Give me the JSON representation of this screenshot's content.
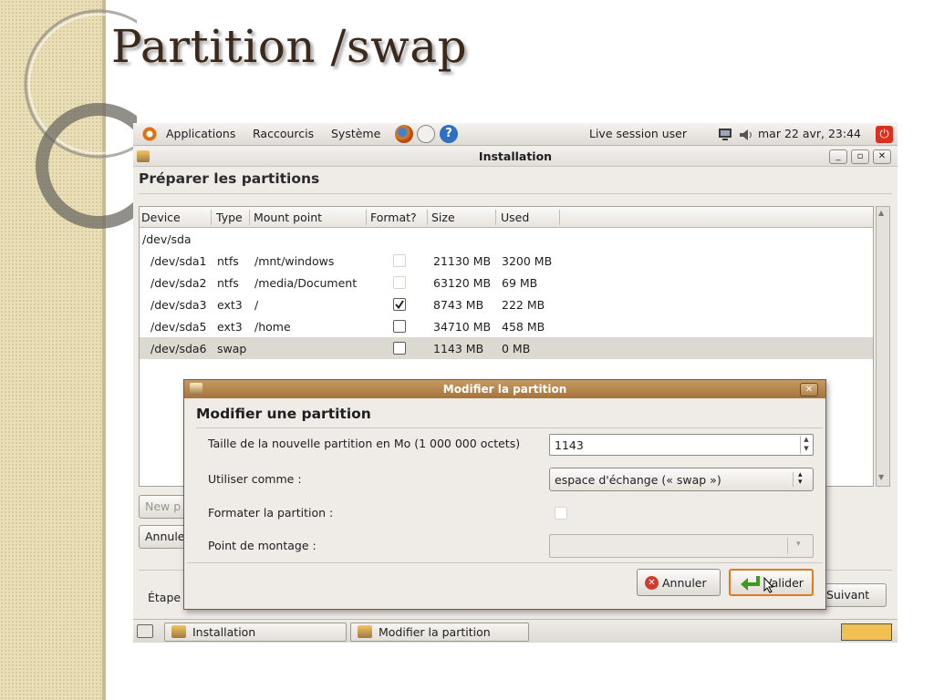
{
  "slide": {
    "title": "Partition /swap"
  },
  "panel": {
    "menus": [
      "Applications",
      "Raccourcis",
      "Système"
    ],
    "user": "Live session user",
    "clock": "mar 22 avr, 23:44"
  },
  "window": {
    "title": "Installation",
    "heading": "Préparer les partitions",
    "columns": [
      "Device",
      "Type",
      "Mount point",
      "Format?",
      "Size",
      "Used"
    ],
    "disk": "/dev/sda",
    "rows": [
      {
        "device": "/dev/sda1",
        "type": "ntfs",
        "mount": "/mnt/windows",
        "format": false,
        "size": "21130 MB",
        "used": "3200 MB"
      },
      {
        "device": "/dev/sda2",
        "type": "ntfs",
        "mount": "/media/Document",
        "format": false,
        "size": "63120 MB",
        "used": "69 MB"
      },
      {
        "device": "/dev/sda3",
        "type": "ext3",
        "mount": "/",
        "format": true,
        "size": "8743 MB",
        "used": "222 MB"
      },
      {
        "device": "/dev/sda5",
        "type": "ext3",
        "mount": "/home",
        "format": false,
        "size": "34710 MB",
        "used": "458 MB"
      },
      {
        "device": "/dev/sda6",
        "type": "swap",
        "mount": "",
        "format": false,
        "size": "1143 MB",
        "used": "0 MB"
      }
    ],
    "new_partition_label": "New p",
    "cancel_changes_label": "Annule",
    "step_label": "Étape",
    "next_label": "Suivant"
  },
  "dialog": {
    "title": "Modifier la partition",
    "heading": "Modifier une partition",
    "size_label": "Taille de la nouvelle partition en Mo (1 000 000 octets)",
    "size_value": "1143",
    "use_as_label": "Utiliser comme :",
    "use_as_value": "espace d'échange (« swap »)",
    "format_label": "Formater la partition :",
    "mount_label": "Point de montage :",
    "mount_value": "",
    "cancel_label": "Annuler",
    "ok_label": "Valider"
  },
  "taskbar": {
    "items": [
      "Installation",
      "Modifier la partition"
    ]
  },
  "colors": {
    "slide_title": "#3b2a1c",
    "dialog_titlebar": "#b5834a",
    "selected_row": "#dcd8d2",
    "focus_orange": "#e07a1f"
  }
}
